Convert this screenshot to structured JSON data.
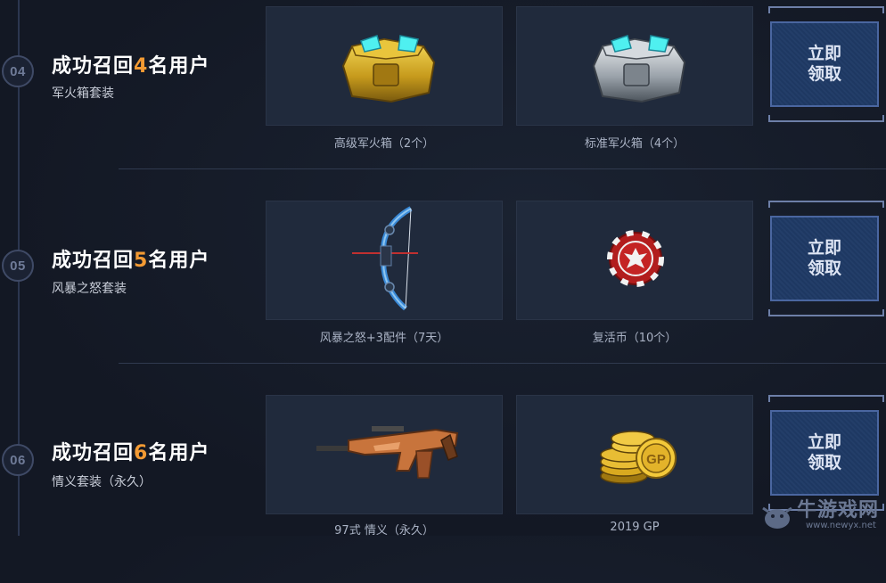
{
  "tiers": [
    {
      "badge": "04",
      "title_prefix": "成功召回",
      "title_num": "4",
      "title_suffix": "名用户",
      "subtitle": "军火箱套装",
      "rewards": [
        {
          "icon": "gold-arms-crate-icon",
          "caption": "高级军火箱（2个）"
        },
        {
          "icon": "silver-arms-crate-icon",
          "caption": "标准军火箱（4个）"
        }
      ],
      "claim_label": "立即领取"
    },
    {
      "badge": "05",
      "title_prefix": "成功召回",
      "title_num": "5",
      "title_suffix": "名用户",
      "subtitle": "风暴之怒套装",
      "rewards": [
        {
          "icon": "compound-bow-icon",
          "caption": "风暴之怒+3配件（7天）"
        },
        {
          "icon": "revive-coin-icon",
          "caption": "复活币（10个）"
        }
      ],
      "claim_label": "立即领取"
    },
    {
      "badge": "06",
      "title_prefix": "成功召回",
      "title_num": "6",
      "title_suffix": "名用户",
      "subtitle": "情义套装（永久）",
      "rewards": [
        {
          "icon": "assault-rifle-icon",
          "caption": "97式 情义（永久）"
        },
        {
          "icon": "gp-coins-icon",
          "caption": "2019 GP"
        }
      ],
      "claim_label": "立即领取"
    }
  ],
  "watermark": {
    "text": "牛游戏网",
    "url": "www.newyx.net"
  },
  "colors": {
    "accent": "#f39a33",
    "button": "#1f3a66",
    "background": "#141a26"
  }
}
